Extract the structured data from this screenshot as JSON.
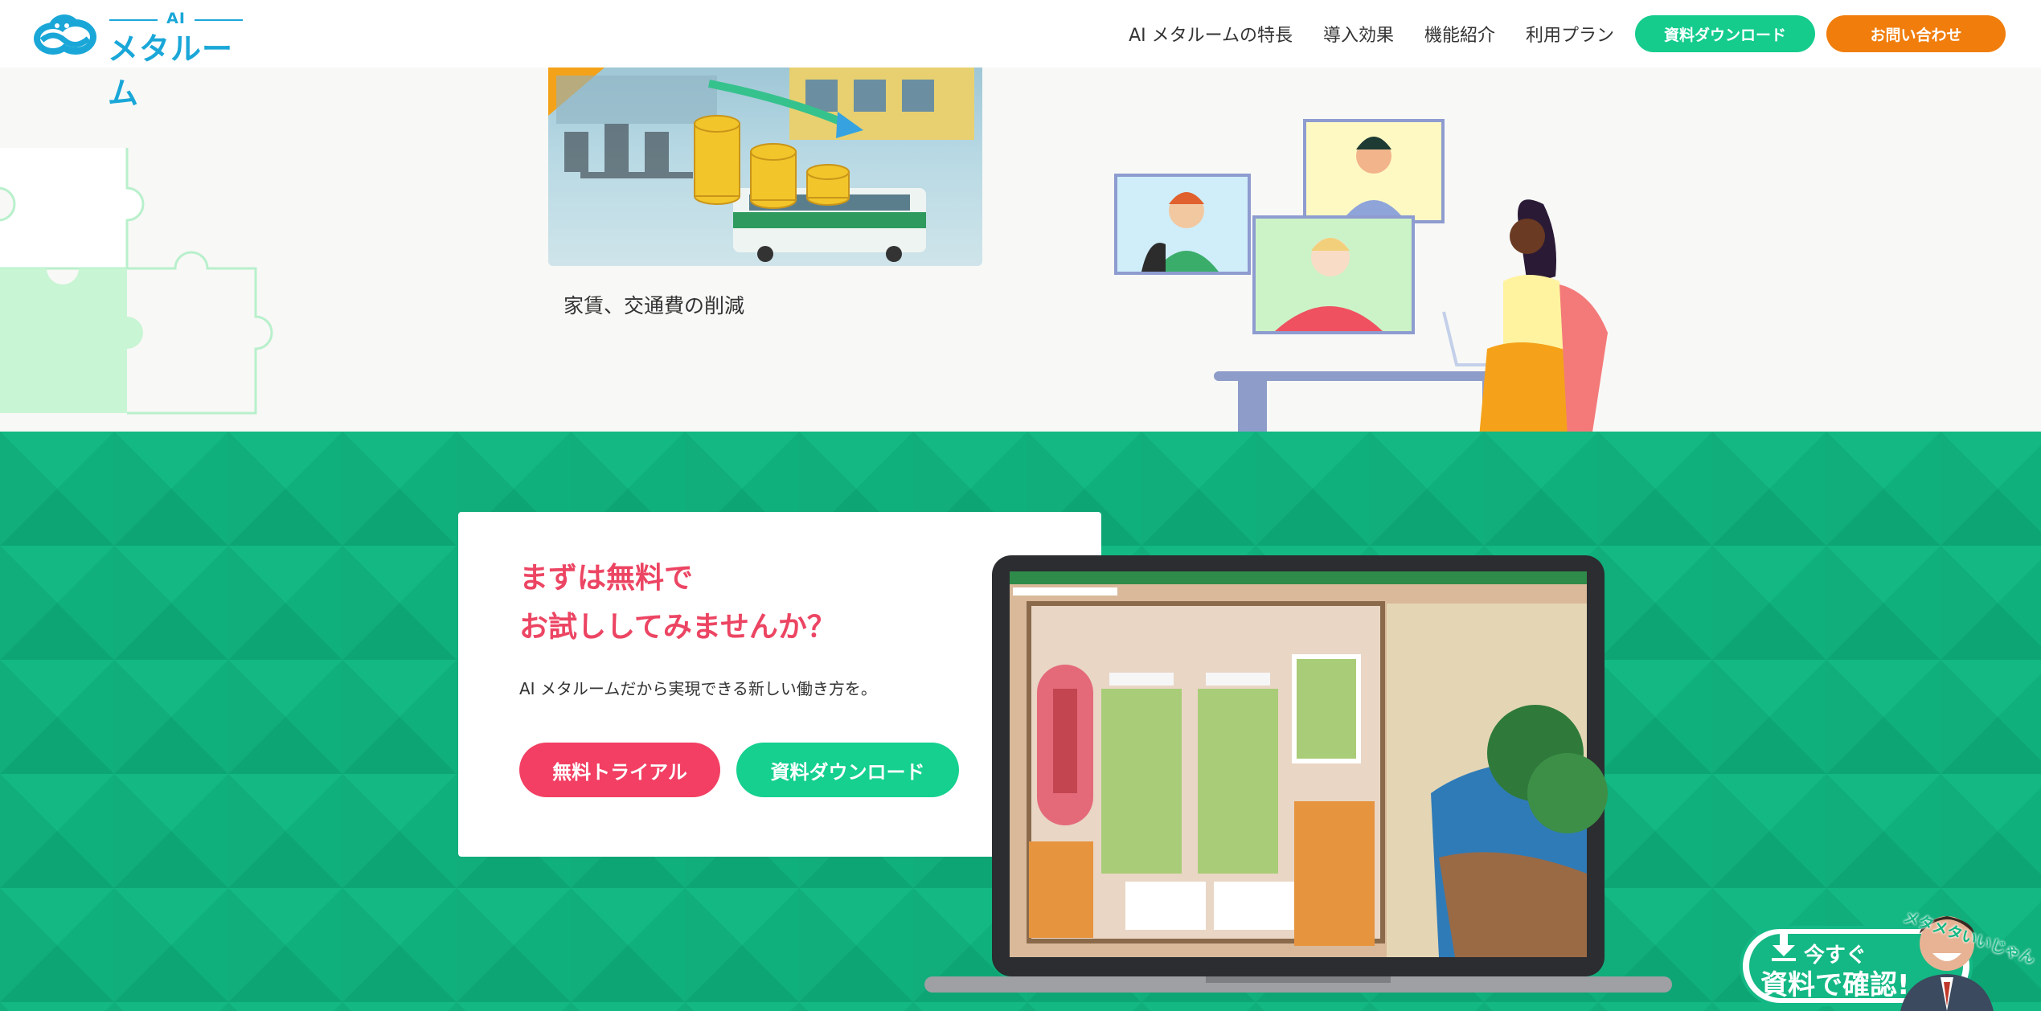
{
  "header": {
    "logo_ai": "AI",
    "logo_text": "メタルーム",
    "nav": [
      {
        "label": "AI メタルームの特長"
      },
      {
        "label": "導入効果"
      },
      {
        "label": "機能紹介"
      },
      {
        "label": "利用プラン"
      }
    ],
    "download_button": "資料ダウンロード",
    "contact_button": "お問い合わせ"
  },
  "upper": {
    "caption": "家賃、交通費の削減"
  },
  "trial_card": {
    "title_line1": "まずは無料で",
    "title_line2": "お試ししてみませんか？",
    "subtitle": "AI メタルームだから実現できる新しい働き方を。",
    "trial_button": "無料トライアル",
    "download_button": "資料ダウンロード"
  },
  "banner": {
    "line1": "今すぐ",
    "line2": "資料で確認!",
    "slogan": "メタメタいいじゃん"
  },
  "colors": {
    "brand_blue": "#1aa7d8",
    "green_button": "#15cc8d",
    "orange_button": "#f07d0c",
    "section_green": "#10b07c",
    "title_pink": "#ec4563",
    "trial_pink": "#f23f63"
  }
}
